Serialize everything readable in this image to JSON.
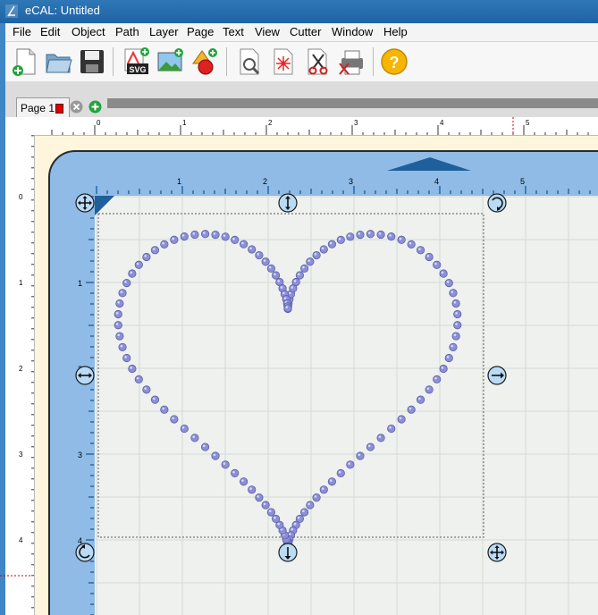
{
  "window": {
    "title": "eCAL: Untitled"
  },
  "menu": [
    "File",
    "Edit",
    "Object",
    "Path",
    "Layer",
    "Page",
    "Text",
    "View",
    "Cutter",
    "Window",
    "Help"
  ],
  "toolbar": {
    "icons": [
      "new-file-icon",
      "open-folder-icon",
      "save-disk-icon",
      "import-svg-icon",
      "import-image-icon",
      "add-shape-icon",
      "print-preview-icon",
      "laser-cut-icon",
      "cut-scissors-icon",
      "print-and-cut-icon",
      "help-icon"
    ],
    "svg_badge": "SVG"
  },
  "tab": {
    "label": "Page 1",
    "color": "#dd0000"
  },
  "outer_ruler": {
    "top_labels": [
      "0",
      "1",
      "2",
      "3",
      "4",
      "5"
    ],
    "left_labels": [
      "0",
      "1",
      "2",
      "3",
      "4"
    ]
  },
  "mat_ruler": {
    "top_labels": [
      "1",
      "2",
      "3",
      "4",
      "5"
    ],
    "left_labels": [
      "1",
      "2",
      "3",
      "4"
    ]
  },
  "colors": {
    "titlebar": "#1e63a6",
    "mat": "#8fbbe6",
    "rhinestone": "#8c8fd6",
    "grid": "#d3dbd3"
  },
  "design": {
    "shape": "heart",
    "element": "rhinestone-dots"
  }
}
